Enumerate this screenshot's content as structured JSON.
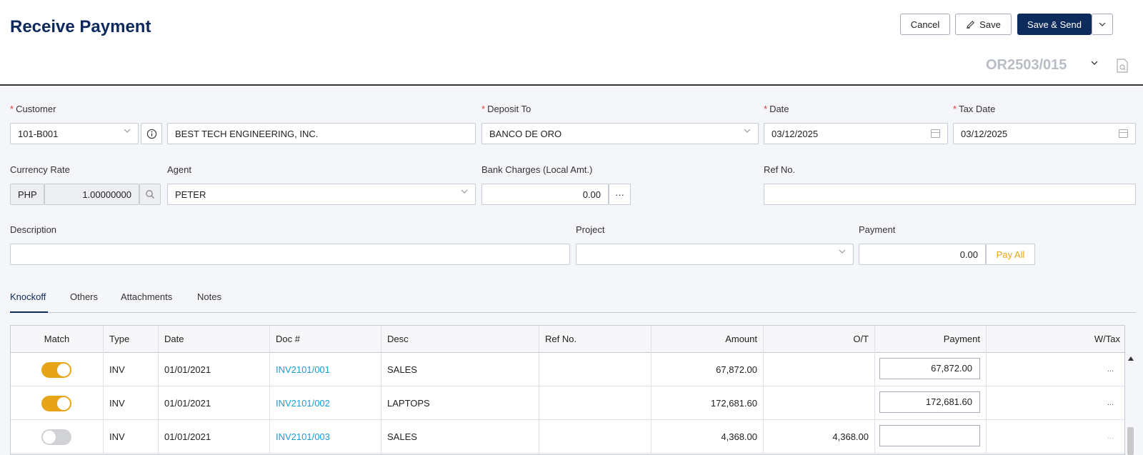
{
  "header": {
    "title": "Receive Payment",
    "cancel_label": "Cancel",
    "save_label": "Save",
    "save_send_label": "Save & Send",
    "doc_number": "OR2503/015"
  },
  "form": {
    "customer": {
      "label": "Customer",
      "code": "101-B001",
      "name": "BEST TECH ENGINEERING, INC."
    },
    "deposit_to": {
      "label": "Deposit To",
      "value": "BANCO DE ORO"
    },
    "date": {
      "label": "Date",
      "value": "03/12/2025"
    },
    "tax_date": {
      "label": "Tax Date",
      "value": "03/12/2025"
    },
    "currency_rate": {
      "label": "Currency Rate",
      "currency": "PHP",
      "rate": "1.00000000"
    },
    "agent": {
      "label": "Agent",
      "value": "PETER"
    },
    "bank_charges": {
      "label": "Bank Charges (Local Amt.)",
      "value": "0.00",
      "more_label": "···"
    },
    "ref_no": {
      "label": "Ref No.",
      "value": ""
    },
    "description": {
      "label": "Description",
      "value": ""
    },
    "project": {
      "label": "Project",
      "value": ""
    },
    "payment": {
      "label": "Payment",
      "value": "0.00",
      "pay_all_label": "Pay All"
    }
  },
  "tabs": [
    {
      "label": "Knockoff",
      "active": true
    },
    {
      "label": "Others",
      "active": false
    },
    {
      "label": "Attachments",
      "active": false
    },
    {
      "label": "Notes",
      "active": false
    }
  ],
  "table": {
    "columns": [
      "Match",
      "Type",
      "Date",
      "Doc #",
      "Desc",
      "Ref No.",
      "Amount",
      "O/T",
      "Payment",
      "W/Tax"
    ],
    "rows": [
      {
        "match": true,
        "type": "INV",
        "date": "01/01/2021",
        "doc": "INV2101/001",
        "desc": "SALES",
        "ref": "",
        "amount": "67,872.00",
        "ot": "",
        "payment": "67,872.00",
        "wtax": "..."
      },
      {
        "match": true,
        "type": "INV",
        "date": "01/01/2021",
        "doc": "INV2101/002",
        "desc": "LAPTOPS",
        "ref": "",
        "amount": "172,681.60",
        "ot": "",
        "payment": "172,681.60",
        "wtax": "..."
      },
      {
        "match": false,
        "type": "INV",
        "date": "01/01/2021",
        "doc": "INV2101/003",
        "desc": "SALES",
        "ref": "",
        "amount": "4,368.00",
        "ot": "4,368.00",
        "payment": "",
        "wtax": "..."
      }
    ]
  },
  "colors": {
    "primary": "#0d2a5c",
    "accent": "#e8a417",
    "link": "#1e9bd7",
    "required": "#e03b3b"
  }
}
